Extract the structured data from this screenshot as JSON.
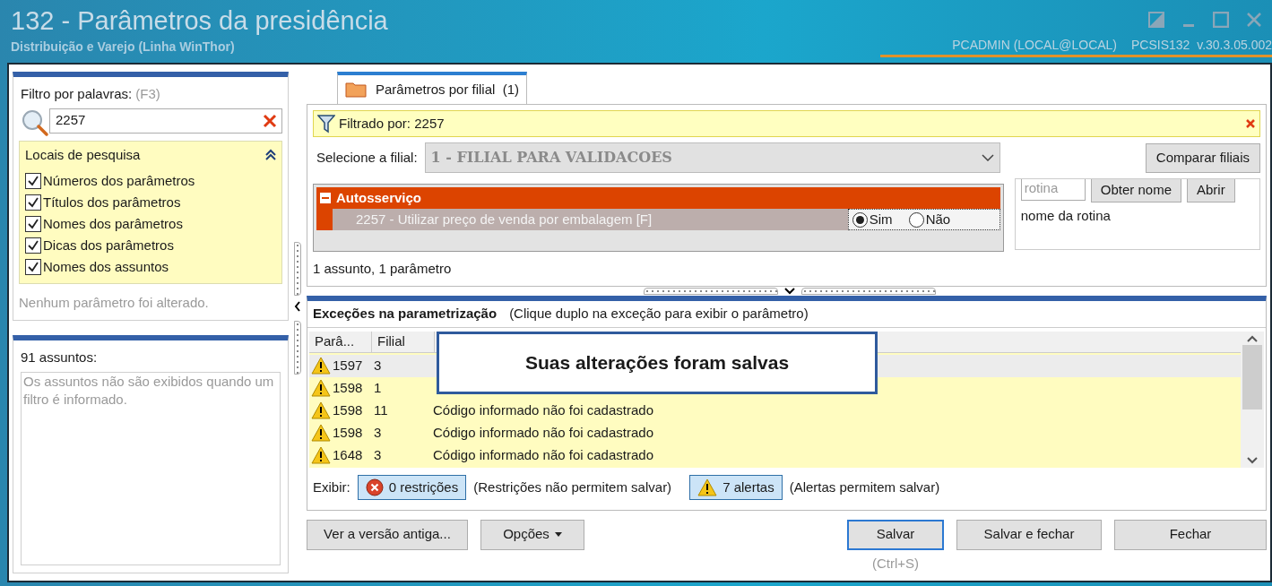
{
  "window": {
    "title": "132 - Parâmetros da presidência",
    "subtitle": "Distribuição e Varejo (Linha WinThor)",
    "user": "PCADMIN (LOCAL@LOCAL)",
    "version": "PCSIS132  v.30.3.05.002"
  },
  "filter_panel": {
    "label": "Filtro por palavras:",
    "shortcut": "(F3)",
    "search_value": "2257",
    "search_locations": {
      "title": "Locais de pesquisa",
      "expanded": true,
      "options": [
        {
          "label": "Números dos parâmetros",
          "checked": true
        },
        {
          "label": "Títulos dos parâmetros",
          "checked": true
        },
        {
          "label": "Nomes dos parâmetros",
          "checked": true
        },
        {
          "label": "Dicas dos parâmetros",
          "checked": true
        },
        {
          "label": "Nomes dos assuntos",
          "checked": true
        }
      ]
    },
    "status": "Nenhum parâmetro foi alterado."
  },
  "subjects_panel": {
    "count_label": "91 assuntos:",
    "message": "Os assuntos não são exibidos quando um filtro é informado."
  },
  "tabs": [
    {
      "label": "Parâmetros por filial",
      "count": "(1)",
      "selected": true
    }
  ],
  "filter_bar": {
    "text": "Filtrado por: 2257"
  },
  "branch": {
    "label": "Selecione a filial:",
    "value": "1 - FILIAL PARA VALIDACOES"
  },
  "compare_button": "Comparar filiais",
  "groups": [
    {
      "name": "Autosserviço",
      "expanded": true,
      "parameters": [
        {
          "text": "2257 - Utilizar preço de venda por embalagem [F]",
          "options": [
            {
              "label": "Sim",
              "selected": true
            },
            {
              "label": "Não",
              "selected": false
            }
          ]
        }
      ]
    }
  ],
  "routine": {
    "placeholder": "rotina",
    "buttons": [
      "Obter nome",
      "Abrir"
    ],
    "name_label": "nome da rotina"
  },
  "summary": "1 assunto, 1 parâmetro",
  "exceptions": {
    "title": "Exceções na parametrização",
    "hint": "(Clique duplo na exceção para exibir o parâmetro)",
    "columns": [
      "Parâ...",
      "Filial"
    ],
    "rows": [
      {
        "param": "1597",
        "branch": "3",
        "selected": true
      },
      {
        "param": "1598",
        "branch": "1",
        "selected": false
      },
      {
        "param": "1598",
        "branch": "11",
        "message": "Código informado não foi cadastrado",
        "selected": false
      },
      {
        "param": "1598",
        "branch": "3",
        "message": "Código informado não foi cadastrado",
        "selected": false
      },
      {
        "param": "1648",
        "branch": "3",
        "message": "Código informado não foi cadastrado",
        "selected": false
      }
    ],
    "show_label": "Exibir:",
    "filters": [
      {
        "kind": "error",
        "label": "0 restrições",
        "note": "(Restrições não permitem salvar)"
      },
      {
        "kind": "warning",
        "label": "7 alertas",
        "note": "(Alertas permitem salvar)"
      }
    ]
  },
  "toast": "Suas alterações foram salvas",
  "buttons": [
    {
      "label": "Ver a versão antiga...",
      "kind": "plain",
      "default": false
    },
    {
      "label": "Opções",
      "kind": "menu",
      "default": false
    },
    {
      "label": "Salvar",
      "kind": "plain",
      "default": true
    },
    {
      "label": "Salvar e fechar",
      "kind": "plain",
      "default": false
    },
    {
      "label": "Fechar",
      "kind": "plain",
      "default": false
    }
  ],
  "shortcut_hint": "(Ctrl+S)"
}
